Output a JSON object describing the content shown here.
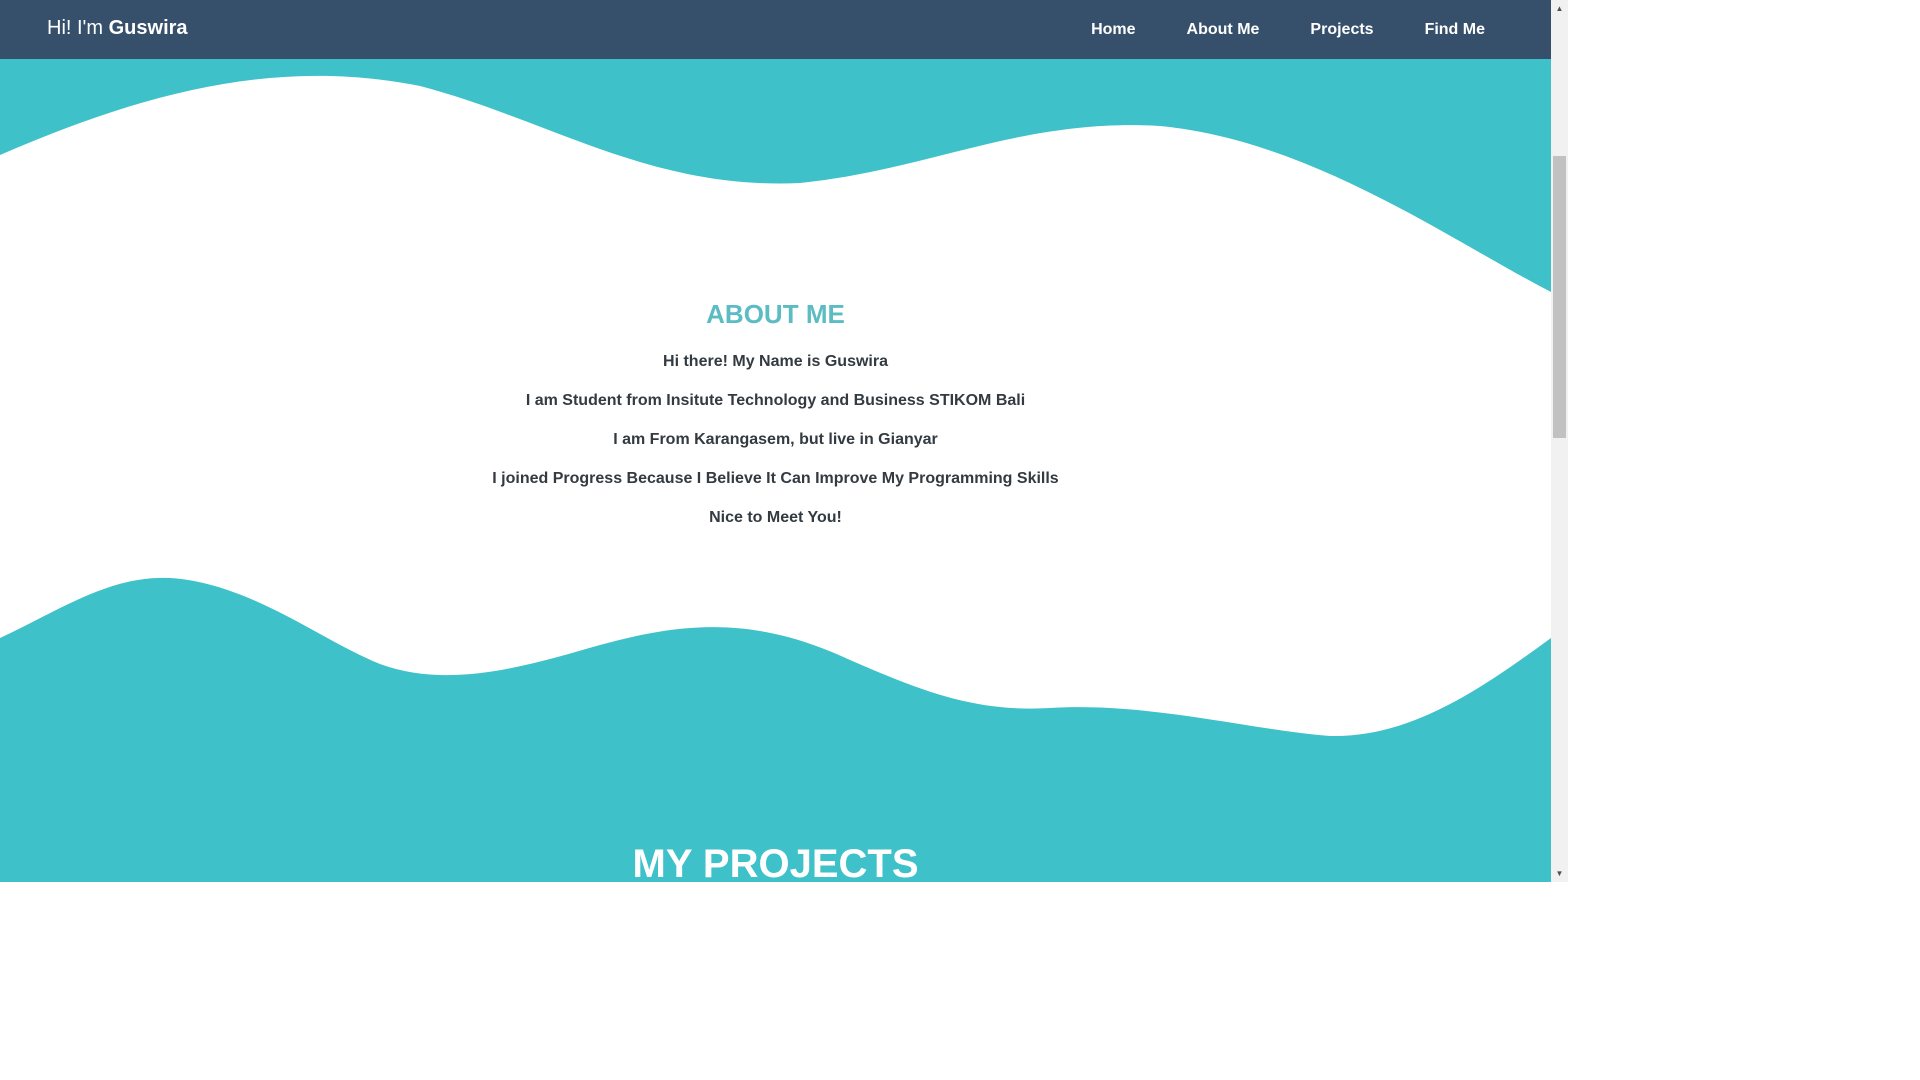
{
  "navbar": {
    "brand_prefix": "Hi! I'm",
    "brand_name": "Guswira",
    "links": [
      "Home",
      "About Me",
      "Projects",
      "Find Me"
    ]
  },
  "about": {
    "title": "ABOUT ME",
    "lines": [
      "Hi there! My Name is Guswira",
      "I am Student from Insitute Technology and Business STIKOM Bali",
      "I am From Karangasem, but live in Gianyar",
      "I joined Progress Because I Believe It Can Improve My Programming Skills",
      "Nice to Meet You!"
    ]
  },
  "projects": {
    "title": "MY PROJECTS"
  },
  "colors": {
    "navbar": "#36506b",
    "wave": "#3ec1c9",
    "about_title": "#5bbcc4",
    "body_text": "#333a40"
  },
  "scrollbar": {
    "up_icon": "triangle-up-icon",
    "down_icon": "triangle-down-icon"
  }
}
